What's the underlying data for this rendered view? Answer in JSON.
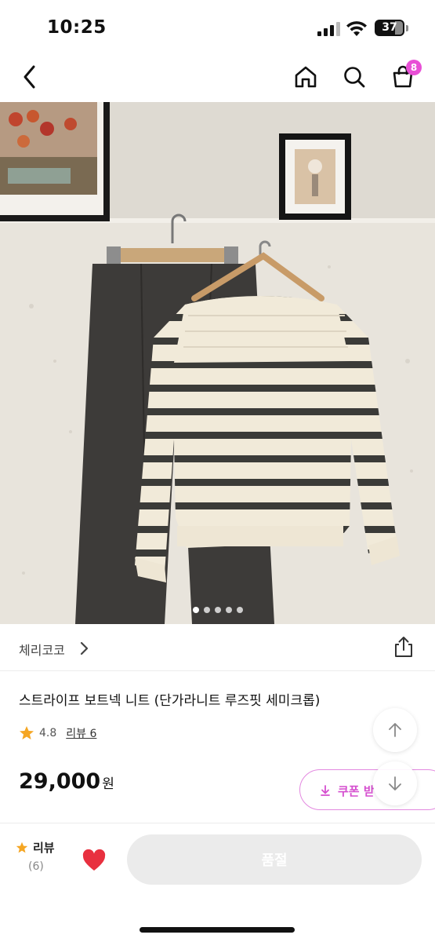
{
  "status_bar": {
    "time": "10:25",
    "battery": "37"
  },
  "nav": {
    "back_icon": "chevron-left-icon",
    "home_icon": "home-icon",
    "search_icon": "search-icon",
    "cart_icon": "shopping-bag-icon",
    "cart_count": "8"
  },
  "product_image": {
    "slide_count": 5,
    "active_slide": 1
  },
  "store": {
    "name": "체리코코",
    "share_icon": "share-icon"
  },
  "product": {
    "title": "스트라이프 보트넥 니트 (단가라니트 루즈핏 세미크롭)",
    "rating": "4.8",
    "review_label": "리뷰 6",
    "price": "29,000",
    "price_unit": "원"
  },
  "coupon": {
    "label": "쿠폰 받"
  },
  "bottom_bar": {
    "review_label": "리뷰",
    "review_count": "(6)",
    "soldout_label": "품절"
  },
  "colors": {
    "accent": "#e84fd6",
    "star": "#f5a623",
    "heart": "#e8303f",
    "disabled_button": "#ebebeb"
  }
}
